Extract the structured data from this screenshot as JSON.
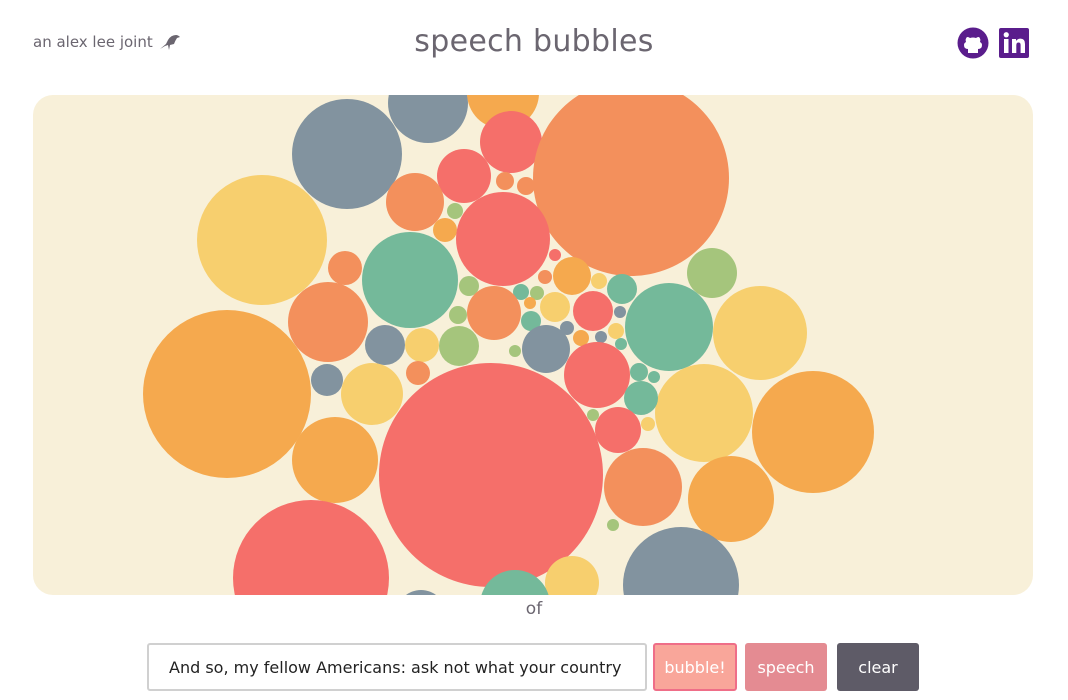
{
  "header": {
    "credit": "an alex lee joint",
    "credit_icon": "crow-icon",
    "title": "speech bubbles",
    "social": [
      {
        "name": "github-icon",
        "color": "#5a1d8c"
      },
      {
        "name": "linkedin-icon",
        "color": "#5a1d8c"
      }
    ]
  },
  "current_word": "of",
  "controls": {
    "speech_input_value": "And so, my fellow Americans: ask not what your country can",
    "bubble_label": "bubble!",
    "speech_label": "speech",
    "clear_label": "clear"
  },
  "colors": {
    "canvas_bg": "#f8f0d9",
    "red": "#f56f6a",
    "orange": "#f3905c",
    "amber": "#f5a94e",
    "yellow": "#f7cf6e",
    "teal": "#74b99a",
    "green": "#a5c57c",
    "slate": "#82939f"
  }
}
